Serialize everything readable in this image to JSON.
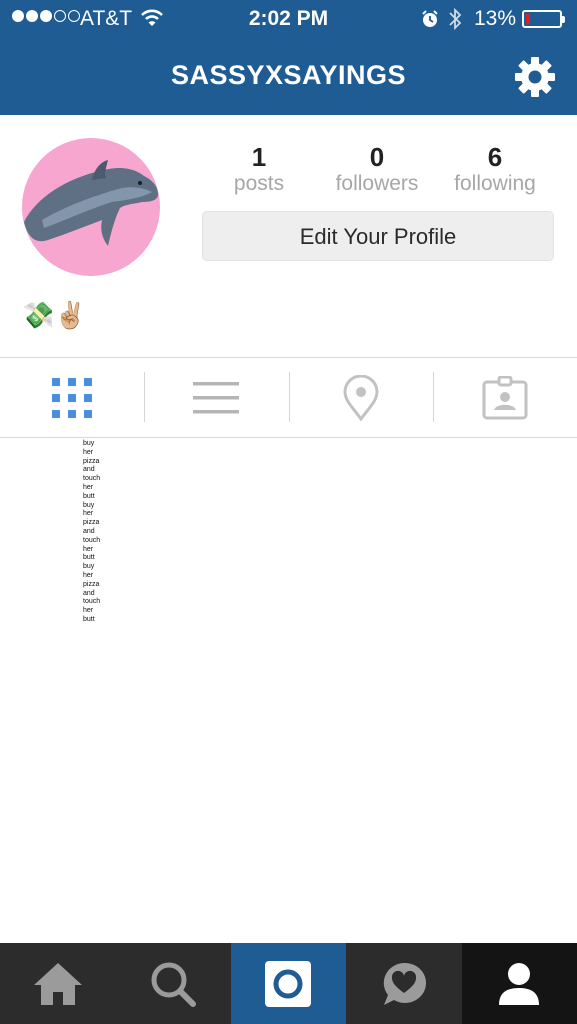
{
  "status_bar": {
    "carrier": "AT&T",
    "time": "2:02 PM",
    "battery_percent": "13%",
    "battery_level": 0.13,
    "signal_bars_filled": 3,
    "signal_bars_total": 5
  },
  "header": {
    "username": "SASSYXSAYINGS",
    "settings_icon": "gear-icon"
  },
  "profile": {
    "stats": [
      {
        "value": "1",
        "label": "posts"
      },
      {
        "value": "0",
        "label": "followers"
      },
      {
        "value": "6",
        "label": "following"
      }
    ],
    "edit_button_label": "Edit Your Profile",
    "bio_emoji": "💸✌🏼"
  },
  "tabs": [
    {
      "name": "grid-view",
      "icon": "grid-icon",
      "active": true
    },
    {
      "name": "list-view",
      "icon": "list-icon",
      "active": false
    },
    {
      "name": "photo-map",
      "icon": "location-pin-icon",
      "active": false
    },
    {
      "name": "tagged-photos",
      "icon": "tagged-person-icon",
      "active": false
    }
  ],
  "post": {
    "words": [
      "buy",
      "her",
      "pizza",
      "and",
      "touch",
      "her",
      "butt",
      "buy",
      "her",
      "pizza",
      "and",
      "touch",
      "her",
      "butt",
      "buy",
      "her",
      "pizza",
      "and",
      "touch",
      "her",
      "butt"
    ]
  },
  "bottom_nav": [
    {
      "name": "home",
      "icon": "home-icon"
    },
    {
      "name": "search",
      "icon": "search-icon"
    },
    {
      "name": "camera",
      "icon": "camera-icon"
    },
    {
      "name": "activity",
      "icon": "heart-bubble-icon"
    },
    {
      "name": "profile",
      "icon": "person-icon"
    }
  ],
  "colors": {
    "header_bg": "#1f5c93",
    "active_tab": "#4a8fd6",
    "inactive_tab": "#b5b5b5",
    "battery_low": "#e02020",
    "avatar_bg": "#f6a6cf"
  }
}
